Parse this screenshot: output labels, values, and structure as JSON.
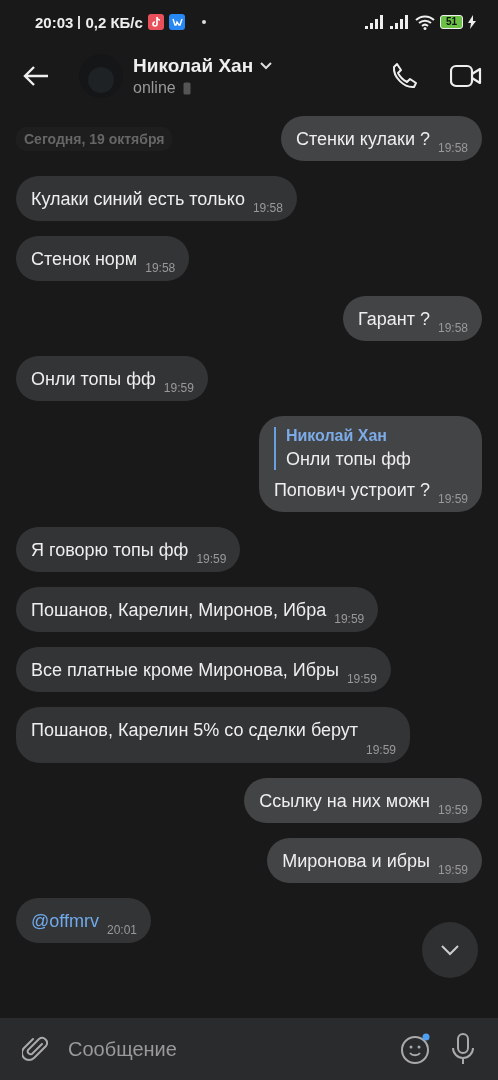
{
  "status_bar": {
    "time": "20:03",
    "speed": "0,2 КБ/с",
    "battery": "51"
  },
  "header": {
    "name": "Николай Хан",
    "status": "online"
  },
  "date_divider": "Сегодня, 19 октября",
  "messages": [
    {
      "kind": "out",
      "text": "Стенки кулаки ?",
      "time": "19:58"
    },
    {
      "kind": "in",
      "text": "Кулаки синий есть только",
      "time": "19:58"
    },
    {
      "kind": "in",
      "text": "Стенок норм",
      "time": "19:58"
    },
    {
      "kind": "out",
      "text": "Гарант ?",
      "time": "19:58"
    },
    {
      "kind": "in",
      "text": "Онли топы фф",
      "time": "19:59"
    },
    {
      "kind": "out",
      "text": "Попович устроит ?",
      "time": "19:59",
      "reply": {
        "author": "Николай Хан",
        "text": "Онли топы фф"
      }
    },
    {
      "kind": "in",
      "text": "Я говорю топы фф",
      "time": "19:59"
    },
    {
      "kind": "in",
      "text": "Пошанов, Карелин, Миронов, Ибра",
      "time": "19:59"
    },
    {
      "kind": "in",
      "text": "Все платные кроме Миронова, Ибры",
      "time": "19:59"
    },
    {
      "kind": "in",
      "text": "Пошанов, Карелин 5% со сделки берут",
      "time": "19:59"
    },
    {
      "kind": "out",
      "text": "Ссылку на них можн",
      "time": "19:59"
    },
    {
      "kind": "out",
      "text": "Миронова и ибры",
      "time": "19:59"
    },
    {
      "kind": "in",
      "text": "@offmrv",
      "time": "20:01",
      "link": true
    }
  ],
  "composer": {
    "placeholder": "Сообщение"
  }
}
